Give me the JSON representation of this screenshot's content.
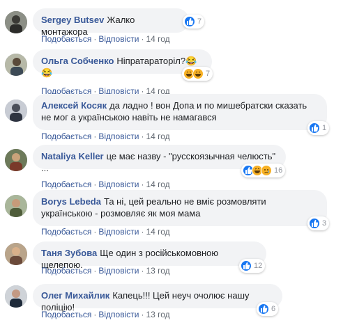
{
  "actions": {
    "like": "Подобається",
    "reply": "Відповісти",
    "separator": "·"
  },
  "colors": {
    "author": "#385898",
    "bubble": "#f2f3f5",
    "like": "#1877f2",
    "haha": "#f7b125"
  },
  "comments": [
    {
      "author": "Sergey Butsev",
      "text": "Жалко монтажора",
      "reactions": [
        "like-icon"
      ],
      "count": "7",
      "time": "14 год"
    },
    {
      "author": "Ольга Собченко",
      "text": "Ніпратараторіл?😂😂",
      "reactions": [
        "haha-icon",
        "haha-icon"
      ],
      "count": "7",
      "time": "14 год"
    },
    {
      "author": "Алексей Косяк",
      "text": "да ладно ! вон Допа и по мишебратски сказать не мог а українською навіть не намагався",
      "reactions": [
        "like-icon"
      ],
      "count": "1",
      "time": "14 год"
    },
    {
      "author": "Nataliya Keller",
      "text": "це має назву - \"русскоязычная челюсть\" ...",
      "reactions": [
        "like-icon",
        "haha-icon",
        "sad-icon"
      ],
      "count": "16",
      "time": "14 год"
    },
    {
      "author": "Borys Lebeda",
      "text": "Та ні, цей реально не вміє розмовляти українською - розмовляє як моя мама",
      "reactions": [
        "like-icon"
      ],
      "count": "3",
      "time": "14 год"
    },
    {
      "author": "Таня Зубова",
      "text": "Ще один з російськомовною щелепою.",
      "reactions": [
        "like-icon"
      ],
      "count": "12",
      "time": "13 год"
    },
    {
      "author": "Олег Михайлик",
      "text": "Капець!!! Цей неуч очолює нашу поліцію!",
      "reactions": [
        "like-icon"
      ],
      "count": "6",
      "time": "13 год"
    }
  ]
}
